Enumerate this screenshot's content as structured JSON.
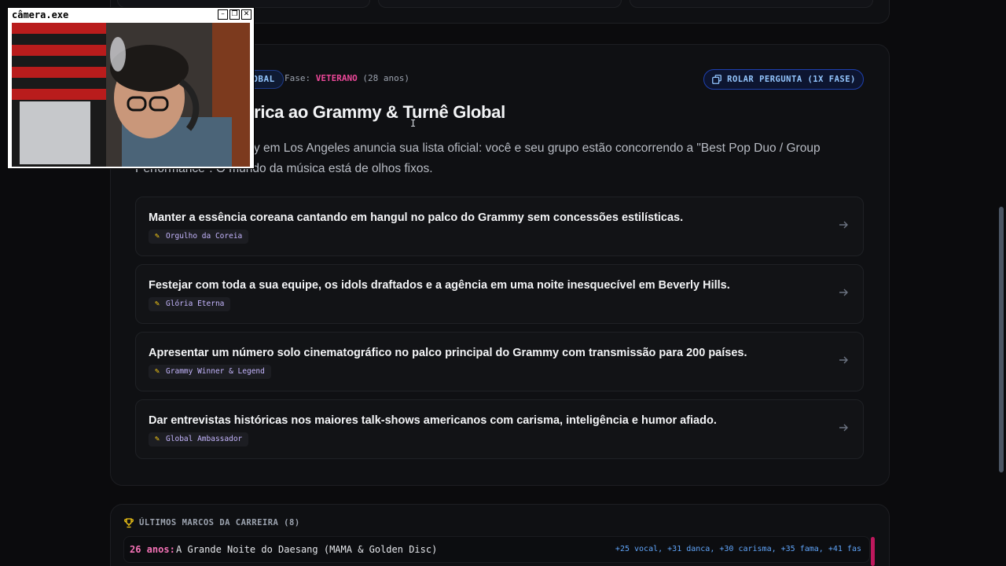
{
  "event": {
    "badge": "GLOBAL",
    "phase_label": "Fase:",
    "phase_value": "VETERANO",
    "phase_age": "(28 anos)",
    "reroll_label": "ROLAR PERGUNTA (1X FASE)",
    "title_partial": "órica ao Grammy & Turnê Global",
    "description_line1": "my em Los Angeles anuncia sua lista oficial: você e seu grupo estão concorrendo a \"Best Pop Duo / Group",
    "description_line2": "Performance\". O mundo da música está de olhos fixos."
  },
  "options": [
    {
      "text": "Manter a essência coreana cantando em hangul no palco do Grammy sem concessões estilísticas.",
      "tag": "Orgulho da Coreia"
    },
    {
      "text": "Festejar com toda a sua equipe, os idols draftados e a agência em uma noite inesquecível em Beverly Hills.",
      "tag": "Glória Eterna"
    },
    {
      "text": "Apresentar um número solo cinematográfico no palco principal do Grammy com transmissão para 200 países.",
      "tag": "Grammy Winner & Legend"
    },
    {
      "text": "Dar entrevistas históricas nos maiores talk-shows americanos com carisma, inteligência e humor afiado.",
      "tag": "Global Ambassador"
    }
  ],
  "camera": {
    "title": "câmera.exe",
    "minimize": "–",
    "restore": "❐",
    "close": "✕"
  },
  "milestones": {
    "header": "ÚLTIMOS MARCOS DA CARREIRA (8)",
    "items": [
      {
        "age": "26 anos:",
        "title": "A Grande Noite do Daesang (MAMA & Golden Disc)",
        "stats": "+25 vocal, +31 danca, +30 carisma, +35 fama, +41 fas"
      }
    ]
  },
  "colors": {
    "accent_pink": "#ec4899",
    "accent_blue": "#93c5fd",
    "background": "#0b0b0d"
  }
}
